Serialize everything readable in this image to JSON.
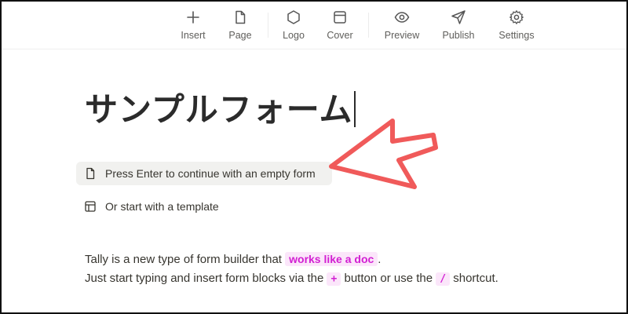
{
  "toolbar": {
    "items": [
      {
        "label": "Insert",
        "icon": "plus-icon"
      },
      {
        "label": "Page",
        "icon": "page-icon"
      },
      {
        "label": "Logo",
        "icon": "hexagon-icon"
      },
      {
        "label": "Cover",
        "icon": "cover-icon"
      },
      {
        "label": "Preview",
        "icon": "eye-icon"
      },
      {
        "label": "Publish",
        "icon": "send-icon"
      },
      {
        "label": "Settings",
        "icon": "gear-icon"
      }
    ]
  },
  "form": {
    "title": "サンプルフォーム"
  },
  "options": {
    "empty_form": "Press Enter to continue with an empty form",
    "template": "Or start with a template"
  },
  "description": {
    "line1_before": "Tally is a new type of form builder that",
    "line1_highlight": "works like a doc",
    "line1_after": ".",
    "line2_before": "Just start typing and insert form blocks via the",
    "line2_key_plus": "+",
    "line2_middle": "button or use the",
    "line2_key_slash": "/",
    "line2_after": "shortcut."
  },
  "colors": {
    "accent_highlight_text": "#d21fd2",
    "accent_highlight_bg": "#fbe6fa",
    "annotation_arrow": "#f05a5a",
    "option_hover_bg": "#f1f1ef"
  }
}
